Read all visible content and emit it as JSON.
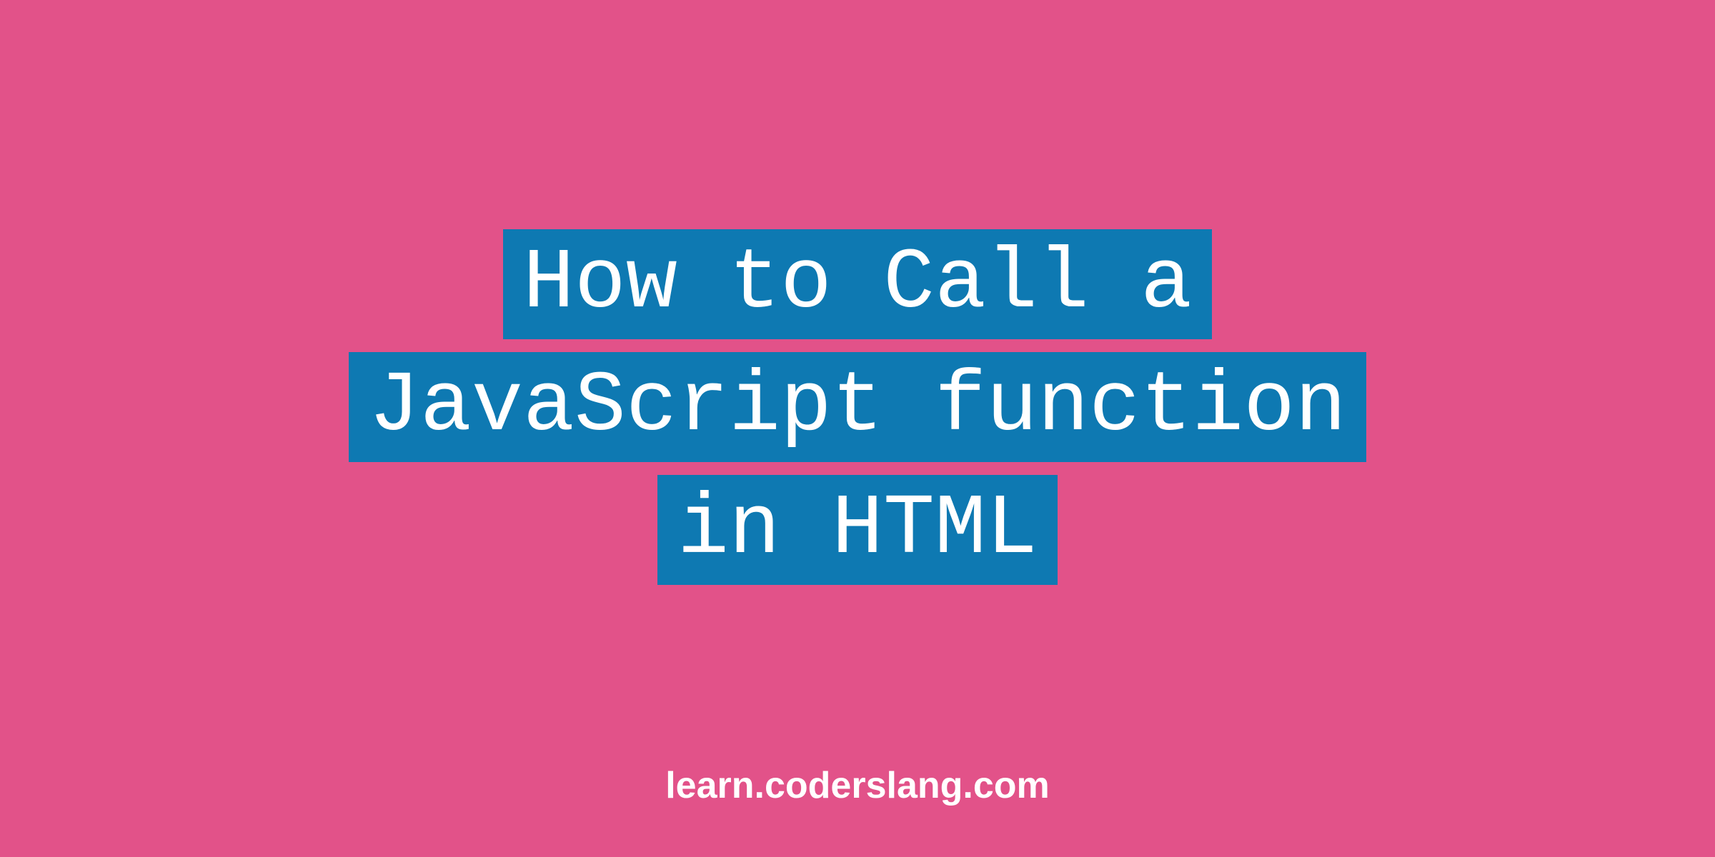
{
  "title": {
    "lines": [
      "How to Call a",
      "JavaScript function",
      "in HTML"
    ]
  },
  "footer": {
    "url": "learn.coderslang.com"
  },
  "colors": {
    "background": "#e25289",
    "highlight": "#0e79b2",
    "text": "#ffffff"
  }
}
